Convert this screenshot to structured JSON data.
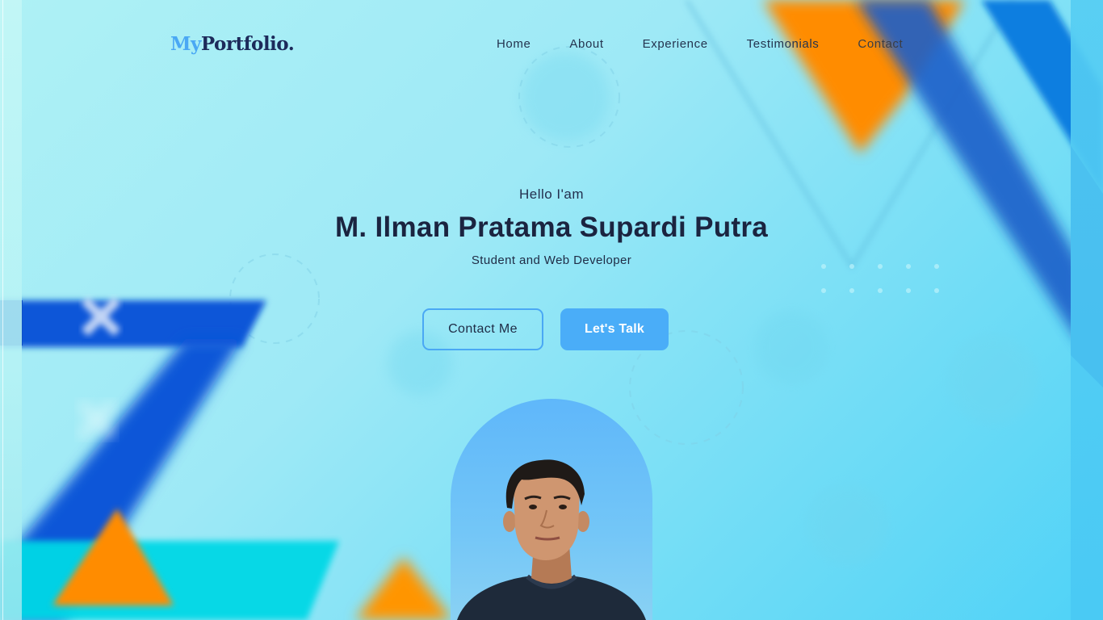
{
  "brand": {
    "prefix": "My",
    "name": "Portfolio."
  },
  "nav": {
    "items": [
      {
        "label": "Home"
      },
      {
        "label": "About"
      },
      {
        "label": "Experience"
      },
      {
        "label": "Testimonials"
      },
      {
        "label": "Contact"
      }
    ]
  },
  "hero": {
    "greeting": "Hello I'am",
    "name": "M. Ilman Pratama Supardi Putra",
    "role": "Student and Web Developer",
    "contact_button": "Contact Me",
    "talk_button": "Let's Talk"
  },
  "colors": {
    "accent": "#4aadf8",
    "text_dark": "#1b2440",
    "orange": "#ff8c00",
    "blue": "#0d57d6"
  }
}
